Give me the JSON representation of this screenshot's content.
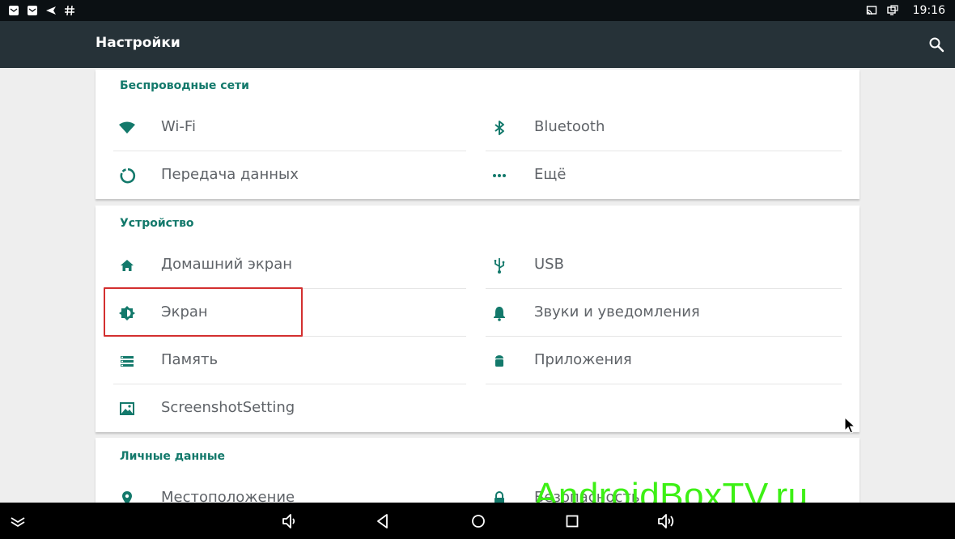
{
  "statusbar": {
    "time": "19:16",
    "left_icons": [
      "mail-icon",
      "mail-icon",
      "send-icon",
      "hash-icon"
    ],
    "right_icons": [
      "cast-icon",
      "screen-icon"
    ]
  },
  "toolbar": {
    "title": "Настройки",
    "search_icon": "search-icon"
  },
  "sections": {
    "wireless": {
      "title": "Беспроводные сети",
      "items": [
        {
          "label": "Wi-Fi",
          "icon": "wifi-icon"
        },
        {
          "label": "Bluetooth",
          "icon": "bluetooth-icon"
        },
        {
          "label": "Передача данных",
          "icon": "data-usage-icon"
        },
        {
          "label": "Ещё",
          "icon": "more-icon"
        }
      ]
    },
    "device": {
      "title": "Устройство",
      "items": [
        {
          "label": "Домашний экран",
          "icon": "home-icon"
        },
        {
          "label": "USB",
          "icon": "usb-icon"
        },
        {
          "label": "Экран",
          "icon": "display-icon"
        },
        {
          "label": "Звуки и уведомления",
          "icon": "bell-icon"
        },
        {
          "label": "Память",
          "icon": "storage-icon"
        },
        {
          "label": "Приложения",
          "icon": "android-icon"
        },
        {
          "label": "ScreenshotSetting",
          "icon": "screenshot-icon"
        }
      ]
    },
    "personal": {
      "title": "Личные данные",
      "items": [
        {
          "label": "Местоположение",
          "icon": "location-icon"
        },
        {
          "label": "Безопасность",
          "icon": "lock-icon"
        }
      ]
    }
  },
  "navbar": {
    "icons": [
      "collapse-icon",
      "volume-down-icon",
      "back-icon",
      "home-circle-icon",
      "recents-icon",
      "volume-up-icon"
    ]
  },
  "watermark": "AndroidBoxTV.ru",
  "colors": {
    "accent": "#13796b",
    "toolbar": "#263238",
    "statusbar": "#0b1013",
    "highlight": "#d32f2f",
    "watermark": "#3df015"
  }
}
